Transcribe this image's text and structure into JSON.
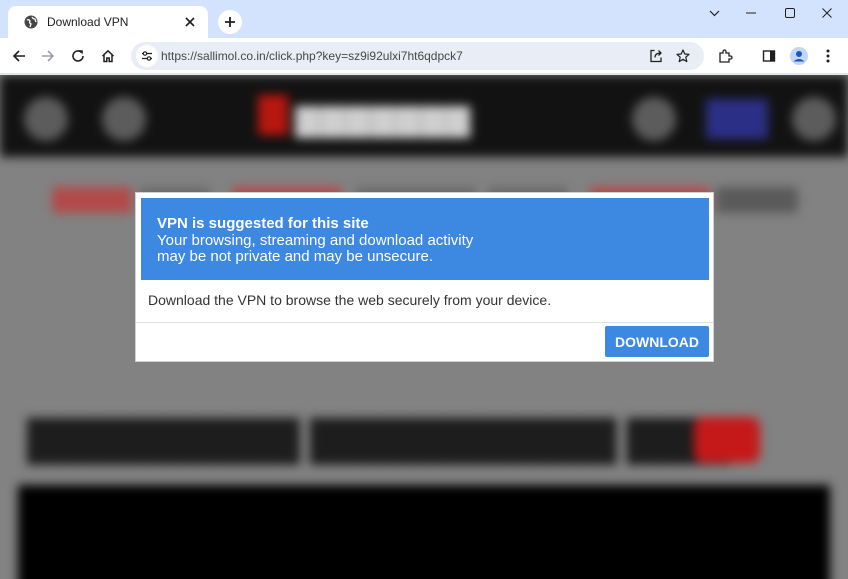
{
  "browser": {
    "tab": {
      "title": "Download VPN",
      "favicon_icon": "globe-icon",
      "close_icon": "close-icon"
    },
    "new_tab_icon": "plus-icon",
    "window_controls": [
      "chevron-down-icon",
      "minimize-icon",
      "maximize-icon",
      "close-icon"
    ],
    "toolbar": {
      "back_icon": "arrow-left-icon",
      "forward_icon": "arrow-right-icon",
      "reload_icon": "reload-icon",
      "home_icon": "home-icon",
      "site_info_icon": "tune-icon",
      "url": "https://sallimol.co.in/click.php?key=sz9i92ulxi7ht6qdpck7",
      "share_icon": "share-icon",
      "bookmark_icon": "star-icon",
      "extensions_icon": "puzzle-icon",
      "sidepanel_icon": "side-panel-icon",
      "profile_icon": "profile-icon",
      "menu_icon": "more-vert-icon"
    }
  },
  "dialog": {
    "title": "VPN is suggested for this site",
    "line1": "Your browsing, streaming and download activity",
    "line2": "may be not private and may be unsecure.",
    "body": "Download the VPN to browse the web securely from your device.",
    "button_label": "DOWNLOAD",
    "accent_color": "#3d88e0"
  }
}
